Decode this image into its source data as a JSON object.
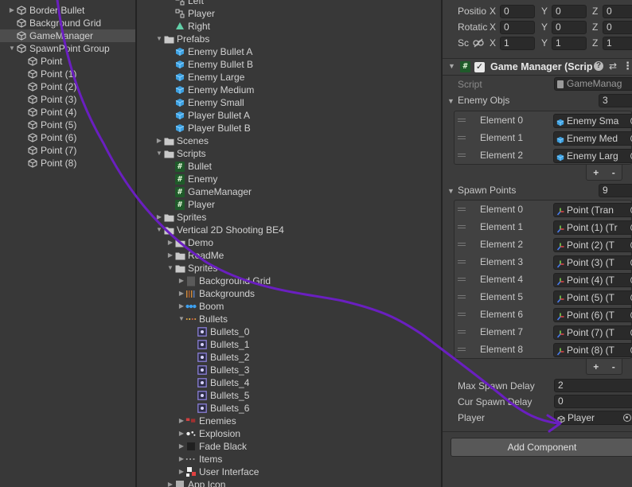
{
  "hierarchy": {
    "items": [
      {
        "label": "Border Bullet",
        "arrow": "▶",
        "selected": false
      },
      {
        "label": "Background Grid",
        "arrow": "",
        "selected": false
      },
      {
        "label": "GameManager",
        "arrow": "",
        "selected": true
      },
      {
        "label": "SpawnPoint Group",
        "arrow": "▼",
        "selected": false
      },
      {
        "label": "Point",
        "arrow": "",
        "selected": false
      },
      {
        "label": "Point (1)",
        "arrow": "",
        "selected": false
      },
      {
        "label": "Point (2)",
        "arrow": "",
        "selected": false
      },
      {
        "label": "Point (3)",
        "arrow": "",
        "selected": false
      },
      {
        "label": "Point (4)",
        "arrow": "",
        "selected": false
      },
      {
        "label": "Point (5)",
        "arrow": "",
        "selected": false
      },
      {
        "label": "Point (6)",
        "arrow": "",
        "selected": false
      },
      {
        "label": "Point (7)",
        "arrow": "",
        "selected": false
      },
      {
        "label": "Point (8)",
        "arrow": "",
        "selected": false
      }
    ]
  },
  "project": {
    "items": [
      {
        "label": "Left",
        "arrow": "",
        "icon": "path"
      },
      {
        "label": "Player",
        "arrow": "",
        "icon": "path"
      },
      {
        "label": "Right",
        "arrow": "",
        "icon": "triangle"
      },
      {
        "label": "Prefabs",
        "arrow": "▼",
        "icon": "folder"
      },
      {
        "label": "Enemy Bullet A",
        "arrow": "",
        "icon": "prefab"
      },
      {
        "label": "Enemy Bullet B",
        "arrow": "",
        "icon": "prefab"
      },
      {
        "label": "Enemy Large",
        "arrow": "",
        "icon": "prefab"
      },
      {
        "label": "Enemy Medium",
        "arrow": "",
        "icon": "prefab"
      },
      {
        "label": "Enemy Small",
        "arrow": "",
        "icon": "prefab"
      },
      {
        "label": "Player Bullet A",
        "arrow": "",
        "icon": "prefab"
      },
      {
        "label": "Player Bullet B",
        "arrow": "",
        "icon": "prefab"
      },
      {
        "label": "Scenes",
        "arrow": "▶",
        "icon": "folder"
      },
      {
        "label": "Scripts",
        "arrow": "▼",
        "icon": "folder"
      },
      {
        "label": "Bullet",
        "arrow": "",
        "icon": "script"
      },
      {
        "label": "Enemy",
        "arrow": "",
        "icon": "script"
      },
      {
        "label": "GameManager",
        "arrow": "",
        "icon": "script"
      },
      {
        "label": "Player",
        "arrow": "",
        "icon": "script"
      },
      {
        "label": "Sprites",
        "arrow": "▶",
        "icon": "folder"
      },
      {
        "label": "Vertical 2D Shooting BE4",
        "arrow": "▼",
        "icon": "folder"
      },
      {
        "label": "Demo",
        "arrow": "▶",
        "icon": "folder"
      },
      {
        "label": "ReadMe",
        "arrow": "▶",
        "icon": "folder"
      },
      {
        "label": "Sprites",
        "arrow": "▼",
        "icon": "folder"
      },
      {
        "label": "Background Grid",
        "arrow": "▶",
        "icon": "sheet-grid"
      },
      {
        "label": "Backgrounds",
        "arrow": "▶",
        "icon": "sheet-bars"
      },
      {
        "label": "Boom",
        "arrow": "▶",
        "icon": "sheet-boom"
      },
      {
        "label": "Bullets",
        "arrow": "▼",
        "icon": "sheet-bullets"
      },
      {
        "label": "Bullets_0",
        "arrow": "",
        "icon": "sprite"
      },
      {
        "label": "Bullets_1",
        "arrow": "",
        "icon": "sprite"
      },
      {
        "label": "Bullets_2",
        "arrow": "",
        "icon": "sprite"
      },
      {
        "label": "Bullets_3",
        "arrow": "",
        "icon": "sprite"
      },
      {
        "label": "Bullets_4",
        "arrow": "",
        "icon": "sprite"
      },
      {
        "label": "Bullets_5",
        "arrow": "",
        "icon": "sprite"
      },
      {
        "label": "Bullets_6",
        "arrow": "",
        "icon": "sprite"
      },
      {
        "label": "Enemies",
        "arrow": "▶",
        "icon": "sheet-enemies"
      },
      {
        "label": "Explosion",
        "arrow": "▶",
        "icon": "sheet-explosion"
      },
      {
        "label": "Fade Black",
        "arrow": "▶",
        "icon": "sheet-black"
      },
      {
        "label": "Items",
        "arrow": "▶",
        "icon": "sheet-items"
      },
      {
        "label": "User Interface",
        "arrow": "▶",
        "icon": "sheet-ui"
      },
      {
        "label": "App Icon",
        "arrow": "▶",
        "icon": "sheet-app"
      }
    ]
  },
  "inspector": {
    "transform": {
      "position_label": "Positio",
      "rotation_label": "Rotatic",
      "scale_label": "Sc",
      "axes": [
        "X",
        "Y",
        "Z"
      ],
      "position": [
        "0",
        "0",
        "0"
      ],
      "rotation": [
        "0",
        "0",
        "0"
      ],
      "scale": [
        "1",
        "1",
        "1"
      ]
    },
    "component": {
      "title": "Game Manager (Scrip",
      "enabled": true,
      "script_label": "Script",
      "script_value": "GameManag"
    },
    "enemy_objs": {
      "label": "Enemy Objs",
      "count": "3",
      "elements": [
        {
          "label": "Element 0",
          "value": "Enemy Sma"
        },
        {
          "label": "Element 1",
          "value": "Enemy Med"
        },
        {
          "label": "Element 2",
          "value": "Enemy Larg"
        }
      ]
    },
    "spawn_points": {
      "label": "Spawn Points",
      "count": "9",
      "elements": [
        {
          "label": "Element 0",
          "value": "Point (Tran"
        },
        {
          "label": "Element 1",
          "value": "Point (1) (Tr"
        },
        {
          "label": "Element 2",
          "value": "Point (2) (T"
        },
        {
          "label": "Element 3",
          "value": "Point (3) (T"
        },
        {
          "label": "Element 4",
          "value": "Point (4) (T"
        },
        {
          "label": "Element 5",
          "value": "Point (5) (T"
        },
        {
          "label": "Element 6",
          "value": "Point (6) (T"
        },
        {
          "label": "Element 7",
          "value": "Point (7) (T"
        },
        {
          "label": "Element 8",
          "value": "Point (8) (T"
        }
      ]
    },
    "max_spawn_delay": {
      "label": "Max Spawn Delay",
      "value": "2"
    },
    "cur_spawn_delay": {
      "label": "Cur Spawn Delay",
      "value": "0"
    },
    "player": {
      "label": "Player",
      "value": "Player"
    },
    "plus": "+",
    "minus": "-",
    "add_component": "Add Component"
  },
  "colors": {
    "accent_path": "#6a1fc0",
    "prefab": "#3b9fe0",
    "script": "#1f5a2a"
  }
}
